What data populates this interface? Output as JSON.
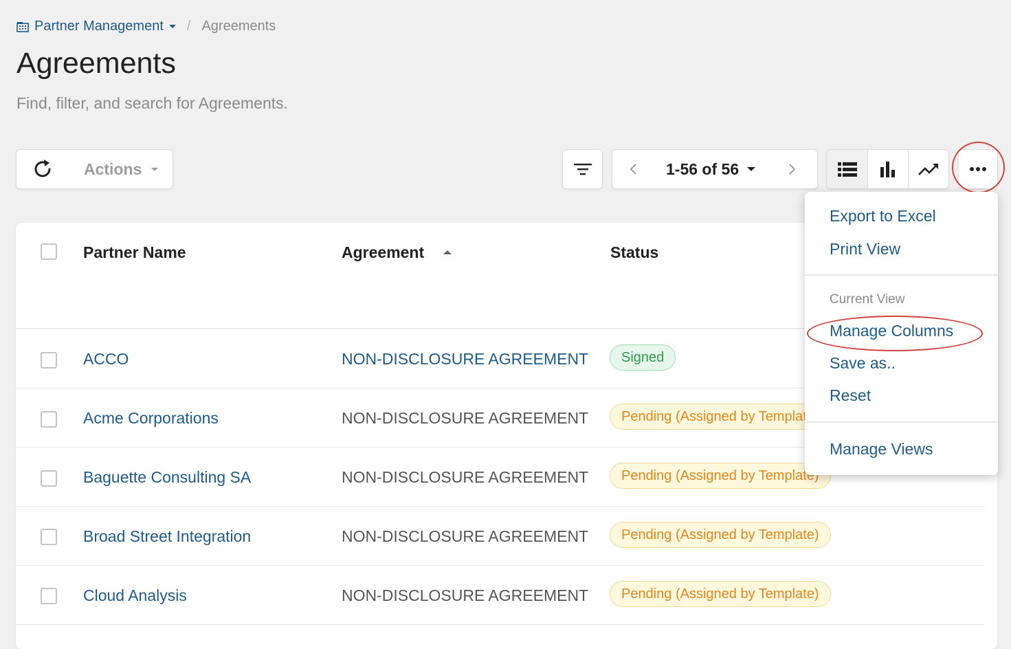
{
  "breadcrumb": {
    "parent": "Partner Management",
    "current": "Agreements"
  },
  "page": {
    "title": "Agreements",
    "subtitle": "Find, filter, and search for Agreements."
  },
  "toolbar": {
    "actions_label": "Actions",
    "pager_text": "1-56 of 56"
  },
  "table": {
    "columns": [
      "Partner Name",
      "Agreement",
      "Status"
    ],
    "sort_column": "Agreement",
    "sort_direction": "ascending",
    "rows": [
      {
        "partner": "ACCO",
        "agreement": "NON-DISCLOSURE AGREEMENT",
        "status": "Signed",
        "status_type": "signed"
      },
      {
        "partner": "Acme Corporations",
        "agreement": "NON-DISCLOSURE AGREEMENT",
        "status": "Pending (Assigned by Template)",
        "status_type": "pending"
      },
      {
        "partner": "Baguette Consulting SA",
        "agreement": "NON-DISCLOSURE AGREEMENT",
        "status": "Pending (Assigned by Template)",
        "status_type": "pending"
      },
      {
        "partner": "Broad Street Integration",
        "agreement": "NON-DISCLOSURE AGREEMENT",
        "status": "Pending (Assigned by Template)",
        "status_type": "pending"
      },
      {
        "partner": "Cloud Analysis",
        "agreement": "NON-DISCLOSURE AGREEMENT",
        "status": "Pending (Assigned by Template)",
        "status_type": "pending"
      }
    ]
  },
  "menu": {
    "export": "Export to Excel",
    "print": "Print View",
    "section_label": "Current View",
    "manage_columns": "Manage Columns",
    "save_as": "Save as..",
    "reset": "Reset",
    "manage_views": "Manage Views"
  },
  "colors": {
    "link": "#1e5b8a",
    "annotation": "#d1433d",
    "signed": "#2e9d4e",
    "pending": "#e0871d"
  },
  "icons": {
    "breadcrumb": "building-icon",
    "refresh": "refresh-icon",
    "filter": "filter-icon",
    "prev": "chevron-left-icon",
    "next": "chevron-right-icon",
    "list_view": "list-view-icon",
    "chart_view": "bar-chart-icon",
    "trend_view": "trend-icon",
    "more": "more-horizontal-icon"
  }
}
